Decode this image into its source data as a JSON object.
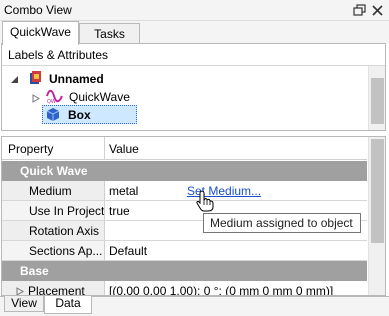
{
  "window": {
    "title": "Combo View"
  },
  "top_tabs": [
    {
      "label": "QuickWave"
    },
    {
      "label": "Tasks"
    }
  ],
  "tree_panel": {
    "header": "Labels & Attributes",
    "items": [
      {
        "label": "Unnamed",
        "bold": true,
        "icon": "document-icon"
      },
      {
        "label": "QuickWave",
        "bold": false,
        "icon": "quickwave-wave-icon"
      },
      {
        "label": "Box",
        "bold": true,
        "icon": "cube-icon",
        "selected": true
      }
    ]
  },
  "property_panel": {
    "columns": {
      "property": "Property",
      "value": "Value"
    },
    "groups": [
      {
        "title": "Quick Wave",
        "rows": [
          {
            "key": "Medium",
            "value": "metal",
            "link": "Set Medium..."
          },
          {
            "key": "Use In Project",
            "value": "true"
          },
          {
            "key": "Rotation Axis",
            "value": ""
          },
          {
            "key": "Sections Ap...",
            "value": "Default"
          }
        ]
      },
      {
        "title": "Base",
        "rows": [
          {
            "key": "Placement",
            "value": "[(0.00 0.00 1.00); 0 °; (0 mm  0 mm  0 mm)]"
          }
        ]
      }
    ]
  },
  "tooltip": {
    "text": "Medium assigned to object"
  },
  "bottom_tabs": [
    {
      "label": "View"
    },
    {
      "label": "Data"
    }
  ],
  "colors": {
    "group_header": "#a0a0a0",
    "link": "#1a4ecb",
    "selection": "#cde8ff"
  }
}
